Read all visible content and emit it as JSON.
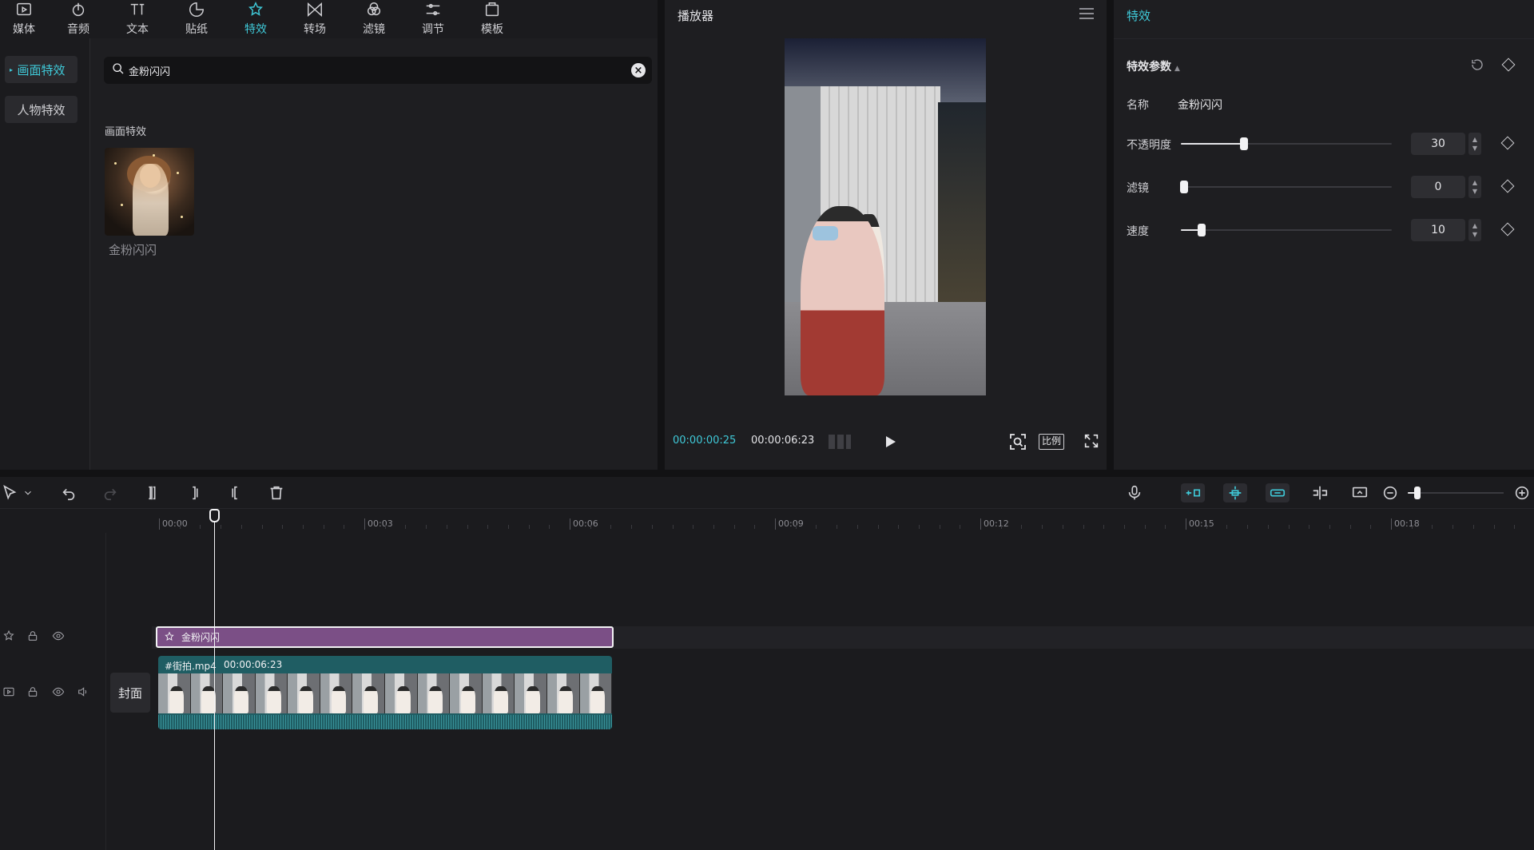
{
  "top_tabs": [
    {
      "label": "媒体",
      "icon": "media-icon"
    },
    {
      "label": "音频",
      "icon": "audio-icon"
    },
    {
      "label": "文本",
      "icon": "text-icon"
    },
    {
      "label": "贴纸",
      "icon": "sticker-icon"
    },
    {
      "label": "特效",
      "icon": "effects-icon",
      "active": true
    },
    {
      "label": "转场",
      "icon": "transition-icon"
    },
    {
      "label": "滤镜",
      "icon": "filter-icon"
    },
    {
      "label": "调节",
      "icon": "adjust-icon"
    },
    {
      "label": "模板",
      "icon": "template-icon"
    }
  ],
  "categories": [
    {
      "label": "画面特效",
      "active": true
    },
    {
      "label": "人物特效",
      "active": false
    }
  ],
  "search": {
    "value": "金粉闪闪",
    "placeholder": ""
  },
  "results": {
    "section_label": "画面特效",
    "items": [
      {
        "name": "金粉闪闪"
      }
    ]
  },
  "player": {
    "title": "播放器",
    "time_current": "00:00:00:25",
    "time_total": "00:00:06:23",
    "ratio_label": "比例"
  },
  "params": {
    "tab": "特效",
    "section": "特效参数",
    "name_label": "名称",
    "name_value": "金粉闪闪",
    "sliders": [
      {
        "label": "不透明度",
        "value": "30",
        "fraction": 0.3
      },
      {
        "label": "滤镜",
        "value": "0",
        "fraction": 0.0
      },
      {
        "label": "速度",
        "value": "10",
        "fraction": 0.1
      }
    ]
  },
  "timeline": {
    "ticks": [
      "00:00",
      "00:03",
      "00:06",
      "00:09",
      "00:12",
      "00:15",
      "00:18"
    ],
    "effect_clip_label": "金粉闪闪",
    "video_clip_name": "#街拍.mp4",
    "video_clip_duration": "00:00:06:23",
    "cover_label": "封面",
    "zoom_fraction": 0.1
  },
  "colors": {
    "accent": "#3fc9d8",
    "effect_clip": "#7b4f86",
    "video_clip": "#1f5d63"
  }
}
